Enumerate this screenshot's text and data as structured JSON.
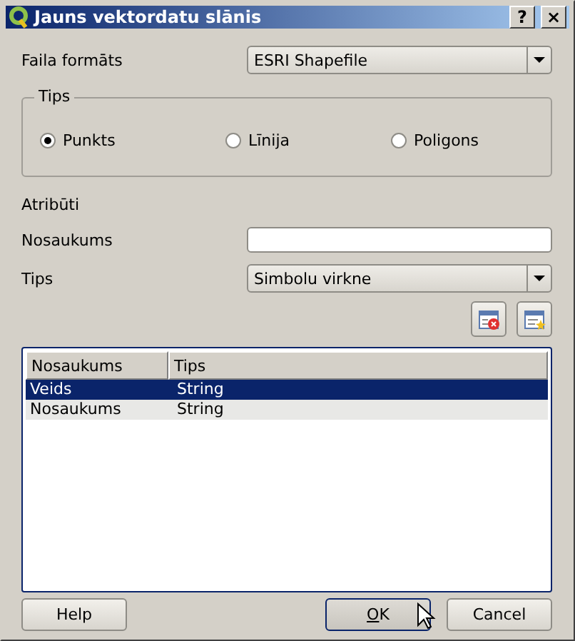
{
  "window": {
    "title": "Jauns vektordatu slānis",
    "title_buttons": [
      "?",
      "×"
    ]
  },
  "file_format": {
    "label": "Faila formāts",
    "value": "ESRI Shapefile"
  },
  "type_group": {
    "title": "Tips",
    "options": [
      {
        "label": "Punkts",
        "selected": true
      },
      {
        "label": "Līnija",
        "selected": false
      },
      {
        "label": "Poligons",
        "selected": false
      }
    ]
  },
  "attributes": {
    "title": "Atribūti",
    "name_label": "Nosaukums",
    "type_label": "Tips",
    "type_value": "Simbolu virkne"
  },
  "table": {
    "columns": [
      "Nosaukums",
      "Tips"
    ],
    "rows": [
      {
        "cells": [
          "Veids",
          "String"
        ],
        "selected": true
      },
      {
        "cells": [
          "Nosaukums",
          "String"
        ],
        "selected": false
      }
    ]
  },
  "buttons": [
    {
      "label": "Help",
      "default": false,
      "mnemonic_underlined": false
    },
    {
      "label": "OK",
      "default": true,
      "mnemonic_underlined": true
    },
    {
      "label": "Cancel",
      "default": false,
      "mnemonic_underlined": false
    }
  ]
}
